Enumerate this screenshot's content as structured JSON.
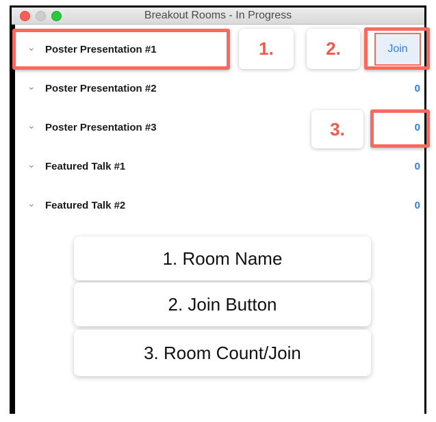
{
  "window": {
    "title": "Breakout Rooms - In Progress"
  },
  "rooms": [
    {
      "name": "Poster Presentation #1",
      "count": "Join"
    },
    {
      "name": "Poster Presentation #2",
      "count": "0"
    },
    {
      "name": "Poster Presentation #3",
      "count": "0"
    },
    {
      "name": "Featured Talk #1",
      "count": "0"
    },
    {
      "name": "Featured Talk #2",
      "count": "0"
    }
  ],
  "badges": [
    "1.",
    "2.",
    "3."
  ],
  "legend": [
    "1. Room Name",
    "2. Join Button",
    "3. Room Count/Join"
  ],
  "icons": {
    "expand": "chevron-down-icon",
    "close": "close-icon",
    "minimize": "minimize-icon",
    "zoom": "zoom-icon"
  },
  "colors": {
    "highlight": "#f96a5e",
    "badge_text": "#f05a4b",
    "link_blue": "#2b7de9"
  }
}
